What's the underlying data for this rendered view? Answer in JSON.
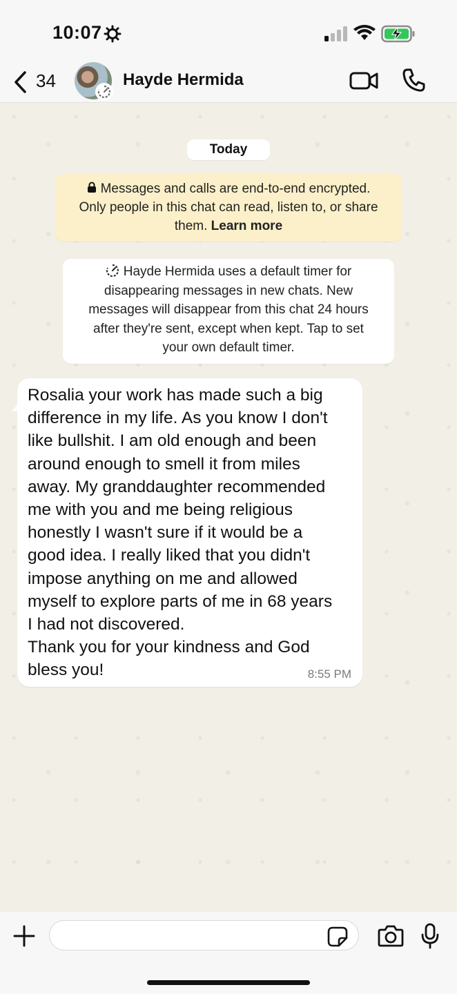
{
  "status_bar": {
    "time": "10:07",
    "icons": [
      "settings-gear-icon",
      "cellular-signal-icon",
      "wifi-icon",
      "battery-charging-icon"
    ],
    "battery_color": "#34c759"
  },
  "header": {
    "back_count": "34",
    "contact_name": "Hayde Hermida",
    "icons": [
      "back-chevron-icon",
      "video-call-icon",
      "phone-call-icon"
    ]
  },
  "chat": {
    "date_label": "Today",
    "encryption_notice": {
      "line1": "Messages and calls are end-to-end encrypted.",
      "line2": "Only people in this chat can read, listen to, or share",
      "line3_start": "them. ",
      "learn_more": "Learn more",
      "bg_color": "#fbf0c9"
    },
    "timer_notice": {
      "line1": "Hayde Hermida uses a default timer for",
      "line2": "disappearing messages in new chats. New",
      "line3": "messages will disappear from this chat 24 hours",
      "line4": "after they're sent, except when kept. Tap to set",
      "line5": "your own default timer."
    },
    "messages": [
      {
        "text": "Rosalia your work has made such a big\ndifference in my life. As you know I don't\nlike bullshit. I am old enough and been\naround enough to smell it from miles\naway. My granddaughter recommended\nme with you and me being religious\nhonestly I wasn't sure if it would be a\ngood idea. I really liked that you didn't\nimpose anything on me and allowed\nmyself to explore parts of me in 68 years\nI had not discovered.\nThank you for your kindness and God\nbless you!",
        "time": "8:55 PM"
      }
    ]
  },
  "composer": {
    "input_value": "",
    "icons": [
      "plus-icon",
      "sticker-icon",
      "camera-icon",
      "microphone-icon"
    ]
  }
}
